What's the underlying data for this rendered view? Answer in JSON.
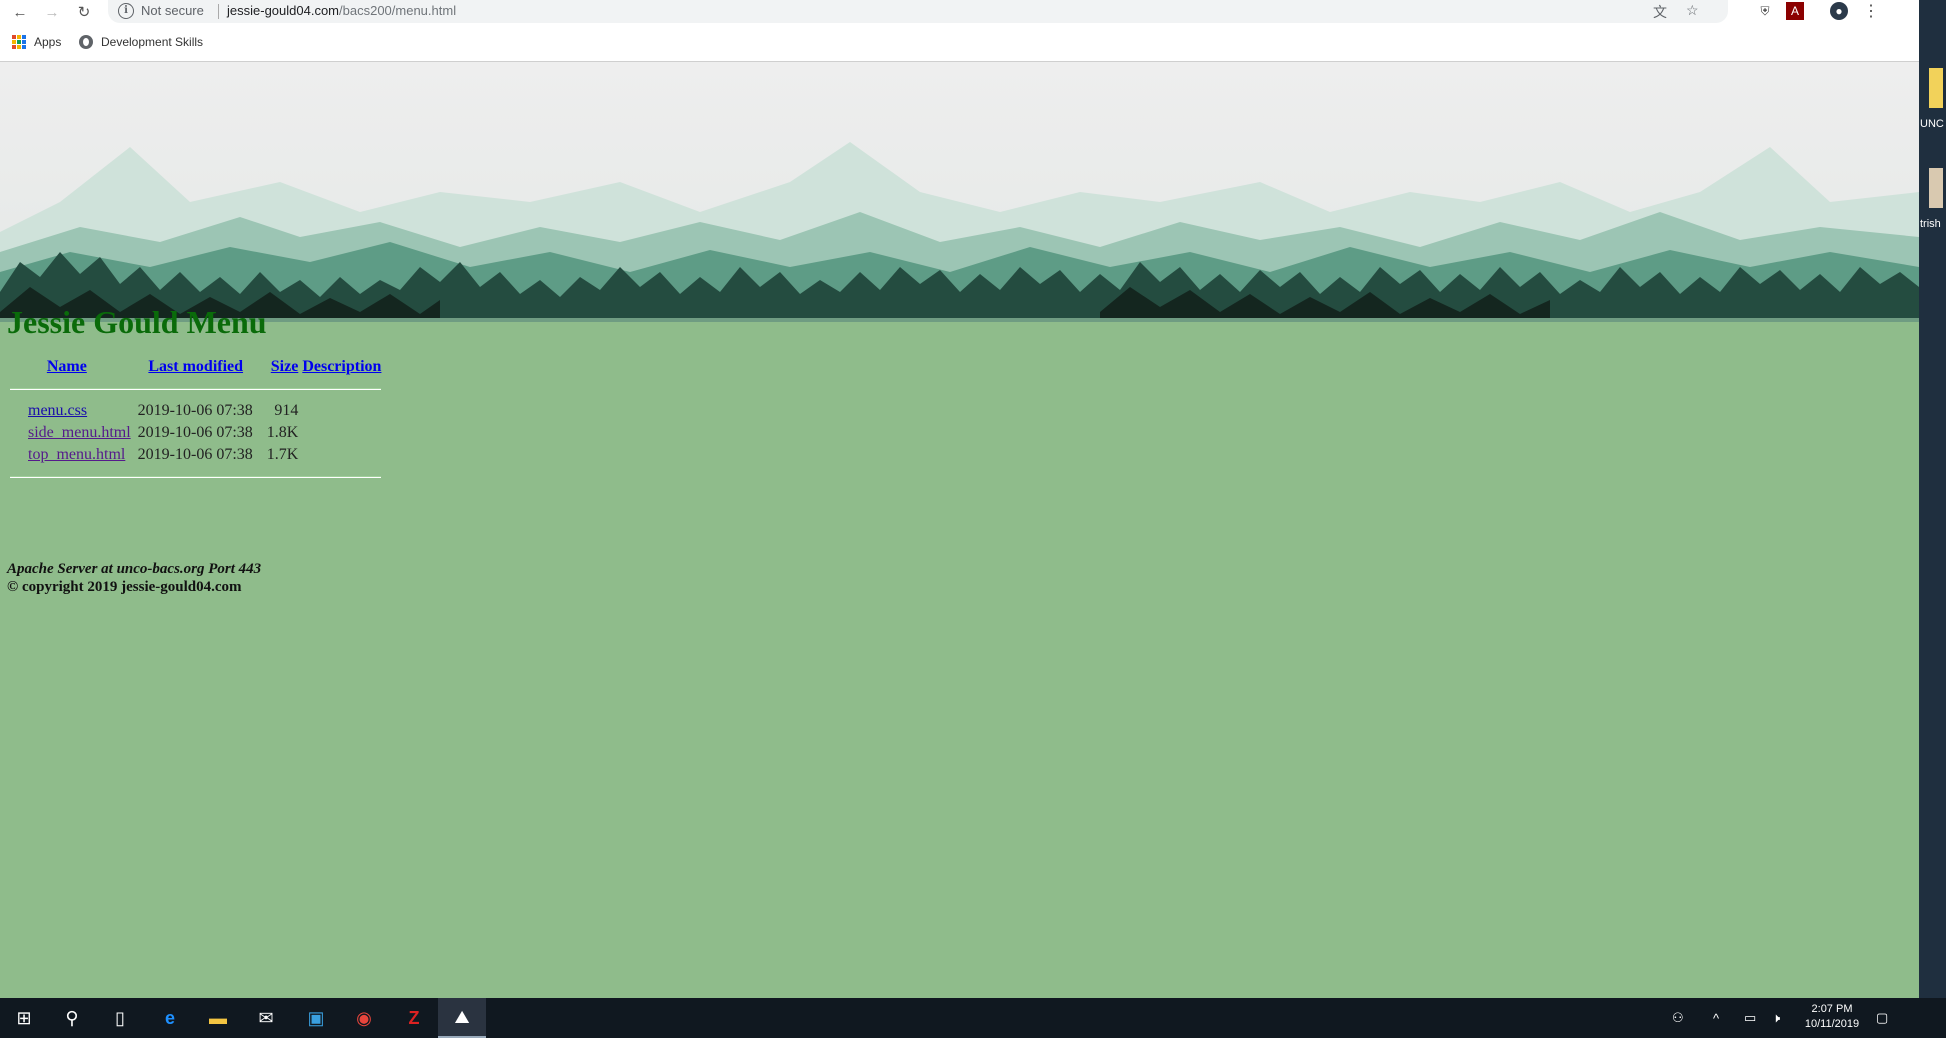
{
  "browser": {
    "security_label": "Not secure",
    "url_domain": "jessie-gould04.com",
    "url_path": "/bacs200/menu.html",
    "bookmarks": [
      {
        "label": "Apps"
      },
      {
        "label": "Development Skills"
      }
    ]
  },
  "page": {
    "title": "Jessie Gould Menu",
    "columns": [
      "Name",
      "Last modified",
      "Size",
      "Description"
    ],
    "files": [
      {
        "name": "menu.css",
        "modified": "2019-10-06 07:38",
        "size": "914",
        "description": ""
      },
      {
        "name": "side_menu.html",
        "modified": "2019-10-06 07:38",
        "size": "1.8K",
        "description": ""
      },
      {
        "name": "top_menu.html",
        "modified": "2019-10-06 07:38",
        "size": "1.7K",
        "description": ""
      }
    ],
    "server_address": "Apache Server at unco-bacs.org Port 443",
    "copyright": "© copyright 2019 jessie-gould04.com",
    "background_color": "#8fbc8b",
    "title_color": "#0a6b0a"
  },
  "desktop": {
    "icons": [
      {
        "label": "UNC"
      },
      {
        "label": "trish"
      }
    ]
  },
  "taskbar": {
    "time": "2:07 PM",
    "date": "10/11/2019"
  }
}
